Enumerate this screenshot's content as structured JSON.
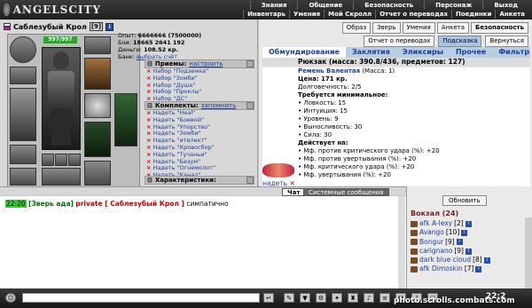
{
  "app": {
    "logo": "ANGELSCITY"
  },
  "nav": {
    "row1": [
      "Знания",
      "Общение",
      "Безопасность",
      "Персонаж",
      "Выход"
    ],
    "row2": [
      "Инвентарь",
      "Умения",
      "Мой Скролл",
      "Отчет о переводах",
      "Поединки",
      "Анкета"
    ]
  },
  "player": {
    "name": "Саблезубый Крол",
    "level": "[9]",
    "hp": "997/997"
  },
  "stats": {
    "exp_label": "Опыт:",
    "exp": "6666666 (7500000)",
    "wins_label": "Бои:",
    "wins": "18665",
    "wins_b": "2641",
    "wins_c": "192",
    "money_label": "Деньги:",
    "money": "108.52 кр.",
    "bank_label": "Банк:",
    "bank_link": "выбрать счёт"
  },
  "priemy": {
    "title": "Приемы:",
    "action": "настроить",
    "items": [
      "Набор \"Подземка\"",
      "Набор \"Зомби\"",
      "Набор \"Душа\"",
      "Набор \"Проклы\"",
      "Набор \"ДС\""
    ]
  },
  "komplekty": {
    "title": "Комплекты:",
    "action": "запомнить",
    "items": [
      "Надеть \"Heal\"",
      "Надеть \"Боевой\"",
      "Надеть \"Упорство\"",
      "Надеть \"Зомби\"",
      "Надеть \"ителект\"",
      "Надеть \"Кровосбор\"",
      "Надеть \"Тучаньи\"",
      "Надеть \"Безум\"",
      "Надеть \"Огнемолот\"",
      "Надеть \"Канал\""
    ]
  },
  "har": {
    "title": "Характеристики:"
  },
  "rightTop": {
    "tabs1": [
      "Образ",
      "Зверь",
      "Умения",
      "Анкета",
      "Безопасность"
    ],
    "tabs2": [
      "Отчет о переводах",
      "Подсказка",
      "Вернуться"
    ]
  },
  "inv": {
    "tabs": [
      "Обмундирование",
      "Заклятия",
      "Эликсиры",
      "Прочее",
      "Фильтр"
    ],
    "backpack": "Рюкзак (масса: 390.8/436, предметов: 127)"
  },
  "item": {
    "name": "Ремень Валентая",
    "mass": "(Масса: 1)",
    "price": "Цена: 171 кр.",
    "dur": "Долговечность: 2/5",
    "req_title": "Требуется минимальное:",
    "reqs": [
      "• Ловкость: 15",
      "• Интуиция: 15",
      "• Уровень: 9",
      "• Выносливость: 30",
      "• Сила: 30"
    ],
    "act_title": "Действует на:",
    "acts": [
      "• Мф. против критического удара (%): +20",
      "• Мф. против увертывания (%): +20",
      "• Мф. критического удара (%): +20",
      "• Мф. увертывания (%): +20"
    ],
    "wear": "надеть"
  },
  "chat": {
    "tab_chat": "Чат",
    "tab_sys": "Системные сообщения",
    "time": "22:20",
    "zone": "[Зверь ада]",
    "priv": "private [ Саблезубый Крол ]",
    "text": "симпатично"
  },
  "online": {
    "refresh": "Обновить",
    "title": "Вокзал (24)",
    "users": [
      {
        "nick": "afk A-lexy",
        "lvl": "[2]"
      },
      {
        "nick": "Avango",
        "lvl": "[10]"
      },
      {
        "nick": "Bongur",
        "lvl": "[9]"
      },
      {
        "nick": "carignano",
        "lvl": "[9]"
      },
      {
        "nick": "dark blue cloud",
        "lvl": "[8]"
      },
      {
        "nick": "afk Dimoskin",
        "lvl": "[7]"
      }
    ]
  },
  "bottom": {
    "clock": "22:2"
  },
  "watermark": "photo.scrolls.combats.com"
}
